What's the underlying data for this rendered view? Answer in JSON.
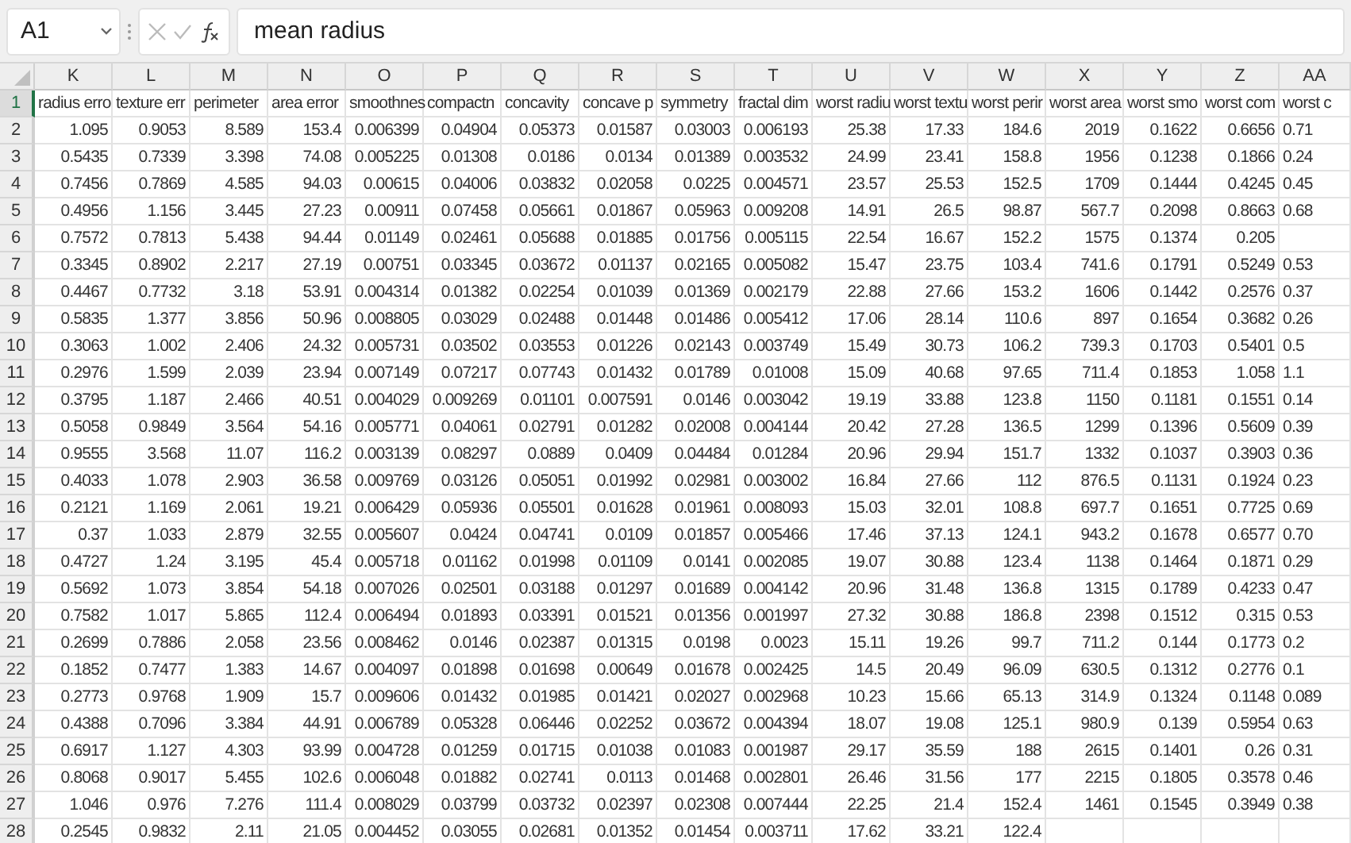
{
  "formula_bar": {
    "name_box": "A1",
    "formula": "mean radius"
  },
  "sheet": {
    "columns": [
      "K",
      "L",
      "M",
      "N",
      "O",
      "P",
      "Q",
      "R",
      "S",
      "T",
      "U",
      "V",
      "W",
      "X",
      "Y",
      "Z",
      "AA"
    ],
    "rows": [
      {
        "number": "1",
        "selected": true,
        "cells": [
          "radius erro",
          "texture err",
          "perimeter",
          "area error",
          "smoothnes",
          "compactn",
          "concavity",
          "concave p",
          "symmetry",
          "fractal dim",
          "worst radiu",
          "worst textu",
          "worst perir",
          "worst area",
          "worst smo",
          "worst com",
          "worst c"
        ]
      },
      {
        "number": "2",
        "selected": false,
        "cells": [
          "1.095",
          "0.9053",
          "8.589",
          "153.4",
          "0.006399",
          "0.04904",
          "0.05373",
          "0.01587",
          "0.03003",
          "0.006193",
          "25.38",
          "17.33",
          "184.6",
          "2019",
          "0.1622",
          "0.6656",
          "0.71"
        ]
      },
      {
        "number": "3",
        "selected": false,
        "cells": [
          "0.5435",
          "0.7339",
          "3.398",
          "74.08",
          "0.005225",
          "0.01308",
          "0.0186",
          "0.0134",
          "0.01389",
          "0.003532",
          "24.99",
          "23.41",
          "158.8",
          "1956",
          "0.1238",
          "0.1866",
          "0.24"
        ]
      },
      {
        "number": "4",
        "selected": false,
        "cells": [
          "0.7456",
          "0.7869",
          "4.585",
          "94.03",
          "0.00615",
          "0.04006",
          "0.03832",
          "0.02058",
          "0.0225",
          "0.004571",
          "23.57",
          "25.53",
          "152.5",
          "1709",
          "0.1444",
          "0.4245",
          "0.45"
        ]
      },
      {
        "number": "5",
        "selected": false,
        "cells": [
          "0.4956",
          "1.156",
          "3.445",
          "27.23",
          "0.00911",
          "0.07458",
          "0.05661",
          "0.01867",
          "0.05963",
          "0.009208",
          "14.91",
          "26.5",
          "98.87",
          "567.7",
          "0.2098",
          "0.8663",
          "0.68"
        ]
      },
      {
        "number": "6",
        "selected": false,
        "cells": [
          "0.7572",
          "0.7813",
          "5.438",
          "94.44",
          "0.01149",
          "0.02461",
          "0.05688",
          "0.01885",
          "0.01756",
          "0.005115",
          "22.54",
          "16.67",
          "152.2",
          "1575",
          "0.1374",
          "0.205"
        ]
      },
      {
        "number": "7",
        "selected": false,
        "cells": [
          "0.3345",
          "0.8902",
          "2.217",
          "27.19",
          "0.00751",
          "0.03345",
          "0.03672",
          "0.01137",
          "0.02165",
          "0.005082",
          "15.47",
          "23.75",
          "103.4",
          "741.6",
          "0.1791",
          "0.5249",
          "0.53"
        ]
      },
      {
        "number": "8",
        "selected": false,
        "cells": [
          "0.4467",
          "0.7732",
          "3.18",
          "53.91",
          "0.004314",
          "0.01382",
          "0.02254",
          "0.01039",
          "0.01369",
          "0.002179",
          "22.88",
          "27.66",
          "153.2",
          "1606",
          "0.1442",
          "0.2576",
          "0.37"
        ]
      },
      {
        "number": "9",
        "selected": false,
        "cells": [
          "0.5835",
          "1.377",
          "3.856",
          "50.96",
          "0.008805",
          "0.03029",
          "0.02488",
          "0.01448",
          "0.01486",
          "0.005412",
          "17.06",
          "28.14",
          "110.6",
          "897",
          "0.1654",
          "0.3682",
          "0.26"
        ]
      },
      {
        "number": "10",
        "selected": false,
        "cells": [
          "0.3063",
          "1.002",
          "2.406",
          "24.32",
          "0.005731",
          "0.03502",
          "0.03553",
          "0.01226",
          "0.02143",
          "0.003749",
          "15.49",
          "30.73",
          "106.2",
          "739.3",
          "0.1703",
          "0.5401",
          "0.5"
        ]
      },
      {
        "number": "11",
        "selected": false,
        "cells": [
          "0.2976",
          "1.599",
          "2.039",
          "23.94",
          "0.007149",
          "0.07217",
          "0.07743",
          "0.01432",
          "0.01789",
          "0.01008",
          "15.09",
          "40.68",
          "97.65",
          "711.4",
          "0.1853",
          "1.058",
          "1.1"
        ]
      },
      {
        "number": "12",
        "selected": false,
        "cells": [
          "0.3795",
          "1.187",
          "2.466",
          "40.51",
          "0.004029",
          "0.009269",
          "0.01101",
          "0.007591",
          "0.0146",
          "0.003042",
          "19.19",
          "33.88",
          "123.8",
          "1150",
          "0.1181",
          "0.1551",
          "0.14"
        ]
      },
      {
        "number": "13",
        "selected": false,
        "cells": [
          "0.5058",
          "0.9849",
          "3.564",
          "54.16",
          "0.005771",
          "0.04061",
          "0.02791",
          "0.01282",
          "0.02008",
          "0.004144",
          "20.42",
          "27.28",
          "136.5",
          "1299",
          "0.1396",
          "0.5609",
          "0.39"
        ]
      },
      {
        "number": "14",
        "selected": false,
        "cells": [
          "0.9555",
          "3.568",
          "11.07",
          "116.2",
          "0.003139",
          "0.08297",
          "0.0889",
          "0.0409",
          "0.04484",
          "0.01284",
          "20.96",
          "29.94",
          "151.7",
          "1332",
          "0.1037",
          "0.3903",
          "0.36"
        ]
      },
      {
        "number": "15",
        "selected": false,
        "cells": [
          "0.4033",
          "1.078",
          "2.903",
          "36.58",
          "0.009769",
          "0.03126",
          "0.05051",
          "0.01992",
          "0.02981",
          "0.003002",
          "16.84",
          "27.66",
          "112",
          "876.5",
          "0.1131",
          "0.1924",
          "0.23"
        ]
      },
      {
        "number": "16",
        "selected": false,
        "cells": [
          "0.2121",
          "1.169",
          "2.061",
          "19.21",
          "0.006429",
          "0.05936",
          "0.05501",
          "0.01628",
          "0.01961",
          "0.008093",
          "15.03",
          "32.01",
          "108.8",
          "697.7",
          "0.1651",
          "0.7725",
          "0.69"
        ]
      },
      {
        "number": "17",
        "selected": false,
        "cells": [
          "0.37",
          "1.033",
          "2.879",
          "32.55",
          "0.005607",
          "0.0424",
          "0.04741",
          "0.0109",
          "0.01857",
          "0.005466",
          "17.46",
          "37.13",
          "124.1",
          "943.2",
          "0.1678",
          "0.6577",
          "0.70"
        ]
      },
      {
        "number": "18",
        "selected": false,
        "cells": [
          "0.4727",
          "1.24",
          "3.195",
          "45.4",
          "0.005718",
          "0.01162",
          "0.01998",
          "0.01109",
          "0.0141",
          "0.002085",
          "19.07",
          "30.88",
          "123.4",
          "1138",
          "0.1464",
          "0.1871",
          "0.29"
        ]
      },
      {
        "number": "19",
        "selected": false,
        "cells": [
          "0.5692",
          "1.073",
          "3.854",
          "54.18",
          "0.007026",
          "0.02501",
          "0.03188",
          "0.01297",
          "0.01689",
          "0.004142",
          "20.96",
          "31.48",
          "136.8",
          "1315",
          "0.1789",
          "0.4233",
          "0.47"
        ]
      },
      {
        "number": "20",
        "selected": false,
        "cells": [
          "0.7582",
          "1.017",
          "5.865",
          "112.4",
          "0.006494",
          "0.01893",
          "0.03391",
          "0.01521",
          "0.01356",
          "0.001997",
          "27.32",
          "30.88",
          "186.8",
          "2398",
          "0.1512",
          "0.315",
          "0.53"
        ]
      },
      {
        "number": "21",
        "selected": false,
        "cells": [
          "0.2699",
          "0.7886",
          "2.058",
          "23.56",
          "0.008462",
          "0.0146",
          "0.02387",
          "0.01315",
          "0.0198",
          "0.0023",
          "15.11",
          "19.26",
          "99.7",
          "711.2",
          "0.144",
          "0.1773",
          "0.2"
        ]
      },
      {
        "number": "22",
        "selected": false,
        "cells": [
          "0.1852",
          "0.7477",
          "1.383",
          "14.67",
          "0.004097",
          "0.01898",
          "0.01698",
          "0.00649",
          "0.01678",
          "0.002425",
          "14.5",
          "20.49",
          "96.09",
          "630.5",
          "0.1312",
          "0.2776",
          "0.1"
        ]
      },
      {
        "number": "23",
        "selected": false,
        "cells": [
          "0.2773",
          "0.9768",
          "1.909",
          "15.7",
          "0.009606",
          "0.01432",
          "0.01985",
          "0.01421",
          "0.02027",
          "0.002968",
          "10.23",
          "15.66",
          "65.13",
          "314.9",
          "0.1324",
          "0.1148",
          "0.089"
        ]
      },
      {
        "number": "24",
        "selected": false,
        "cells": [
          "0.4388",
          "0.7096",
          "3.384",
          "44.91",
          "0.006789",
          "0.05328",
          "0.06446",
          "0.02252",
          "0.03672",
          "0.004394",
          "18.07",
          "19.08",
          "125.1",
          "980.9",
          "0.139",
          "0.5954",
          "0.63"
        ]
      },
      {
        "number": "25",
        "selected": false,
        "cells": [
          "0.6917",
          "1.127",
          "4.303",
          "93.99",
          "0.004728",
          "0.01259",
          "0.01715",
          "0.01038",
          "0.01083",
          "0.001987",
          "29.17",
          "35.59",
          "188",
          "2615",
          "0.1401",
          "0.26",
          "0.31"
        ]
      },
      {
        "number": "26",
        "selected": false,
        "cells": [
          "0.8068",
          "0.9017",
          "5.455",
          "102.6",
          "0.006048",
          "0.01882",
          "0.02741",
          "0.0113",
          "0.01468",
          "0.002801",
          "26.46",
          "31.56",
          "177",
          "2215",
          "0.1805",
          "0.3578",
          "0.46"
        ]
      },
      {
        "number": "27",
        "selected": false,
        "cells": [
          "1.046",
          "0.976",
          "7.276",
          "111.4",
          "0.008029",
          "0.03799",
          "0.03732",
          "0.02397",
          "0.02308",
          "0.007444",
          "22.25",
          "21.4",
          "152.4",
          "1461",
          "0.1545",
          "0.3949",
          "0.38"
        ]
      },
      {
        "number": "28",
        "selected": false,
        "cells": [
          "0.2545",
          "0.9832",
          "2.11",
          "21.05",
          "0.004452",
          "0.03055",
          "0.02681",
          "0.01352",
          "0.01454",
          "0.003711",
          "17.62",
          "33.21",
          "122.4"
        ]
      }
    ]
  }
}
